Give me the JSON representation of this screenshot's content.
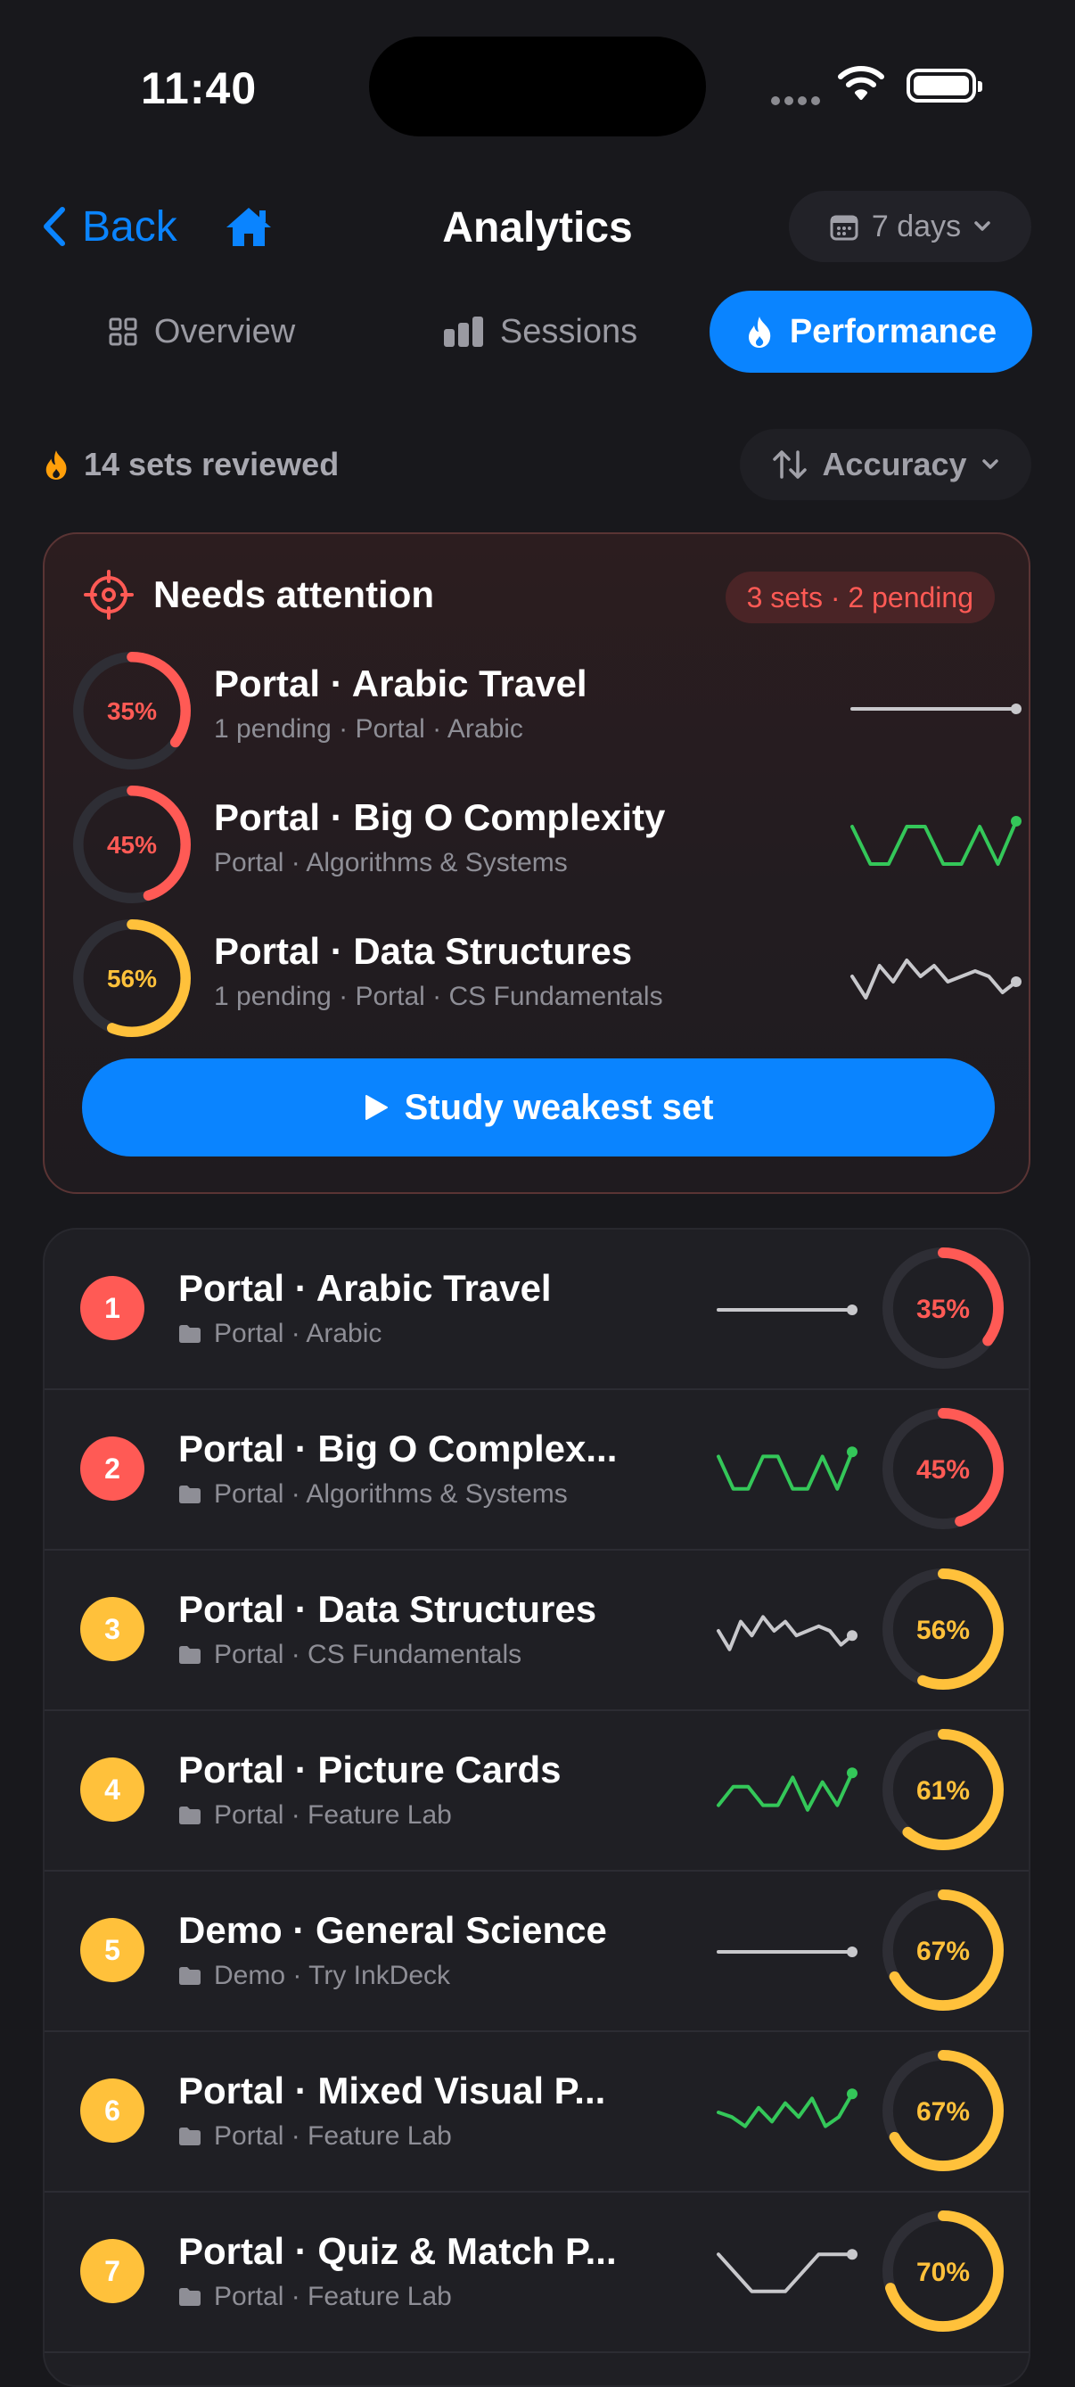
{
  "status": {
    "time": "11:40"
  },
  "nav": {
    "back_label": "Back",
    "title": "Analytics",
    "range_label": "7 days"
  },
  "tabs": [
    {
      "label": "Overview",
      "icon": "grid-icon",
      "active": false
    },
    {
      "label": "Sessions",
      "icon": "bar-chart-icon",
      "active": false
    },
    {
      "label": "Performance",
      "icon": "flame-icon",
      "active": true
    }
  ],
  "summary": {
    "reviewed_label": "14 sets reviewed",
    "sort_label": "Accuracy"
  },
  "attention": {
    "title": "Needs attention",
    "badge": "3 sets · 2 pending",
    "button_label": "Study weakest set",
    "items": [
      {
        "title": "Portal · Arabic Travel",
        "subtitle": "1 pending · Portal · Arabic",
        "pct": 35,
        "pct_label": "35%",
        "color": "#ff5a55",
        "spark": [
          0.5,
          0.5,
          0.5,
          0.5
        ],
        "spark_color": "#c8c8cc"
      },
      {
        "title": "Portal · Big O Complexity",
        "subtitle": "Portal · Algorithms & Systems",
        "pct": 45,
        "pct_label": "45%",
        "color": "#ff5a55",
        "spark": [
          0.2,
          0.9,
          0.9,
          0.2,
          0.2,
          0.9,
          0.9,
          0.2,
          0.9,
          0.1
        ],
        "spark_color": "#34c759"
      },
      {
        "title": "Portal · Data Structures",
        "subtitle": "1 pending · Portal · CS Fundamentals",
        "pct": 56,
        "pct_label": "56%",
        "color": "#ffc13b",
        "spark": [
          0.5,
          0.9,
          0.3,
          0.6,
          0.2,
          0.5,
          0.3,
          0.6,
          0.5,
          0.4,
          0.5,
          0.8,
          0.6
        ],
        "spark_color": "#c8c8cc"
      }
    ]
  },
  "sets": [
    {
      "rank": "1",
      "title": "Portal · Arabic Travel",
      "subtitle": "Portal · Arabic",
      "pct": 35,
      "pct_label": "35%",
      "color": "#ff5a55",
      "spark": [
        0.5,
        0.5,
        0.5,
        0.5
      ],
      "spark_color": "#c8c8cc"
    },
    {
      "rank": "2",
      "title": "Portal · Big O Complex...",
      "subtitle": "Portal · Algorithms & Systems",
      "pct": 45,
      "pct_label": "45%",
      "color": "#ff5a55",
      "spark": [
        0.2,
        0.9,
        0.9,
        0.2,
        0.2,
        0.9,
        0.9,
        0.2,
        0.9,
        0.1
      ],
      "spark_color": "#34c759"
    },
    {
      "rank": "3",
      "title": "Portal · Data Structures",
      "subtitle": "Portal · CS Fundamentals",
      "pct": 56,
      "pct_label": "56%",
      "color": "#ffc13b",
      "spark": [
        0.5,
        0.9,
        0.3,
        0.6,
        0.2,
        0.5,
        0.3,
        0.6,
        0.5,
        0.4,
        0.5,
        0.8,
        0.6
      ],
      "spark_color": "#c8c8cc"
    },
    {
      "rank": "4",
      "title": "Portal · Picture Cards",
      "subtitle": "Portal · Feature Lab",
      "pct": 61,
      "pct_label": "61%",
      "color": "#ffc13b",
      "spark": [
        0.8,
        0.4,
        0.4,
        0.8,
        0.8,
        0.2,
        0.9,
        0.3,
        0.8,
        0.1
      ],
      "spark_color": "#34c759"
    },
    {
      "rank": "5",
      "title": "Demo · General Science",
      "subtitle": "Demo · Try InkDeck",
      "pct": 67,
      "pct_label": "67%",
      "color": "#ffc13b",
      "spark": [
        0.5,
        0.5,
        0.5,
        0.5
      ],
      "spark_color": "#c8c8cc"
    },
    {
      "rank": "6",
      "title": "Portal · Mixed Visual P...",
      "subtitle": "Portal · Feature Lab",
      "pct": 67,
      "pct_label": "67%",
      "color": "#ffc13b",
      "spark": [
        0.5,
        0.6,
        0.8,
        0.4,
        0.7,
        0.3,
        0.6,
        0.2,
        0.8,
        0.6,
        0.1
      ],
      "spark_color": "#34c759"
    },
    {
      "rank": "7",
      "title": "Portal · Quiz & Match P...",
      "subtitle": "Portal · Feature Lab",
      "pct": 70,
      "pct_label": "70%",
      "color": "#ffc13b",
      "spark": [
        0.1,
        0.9,
        0.9,
        0.1,
        0.1
      ],
      "spark_color": "#c8c8cc"
    }
  ]
}
